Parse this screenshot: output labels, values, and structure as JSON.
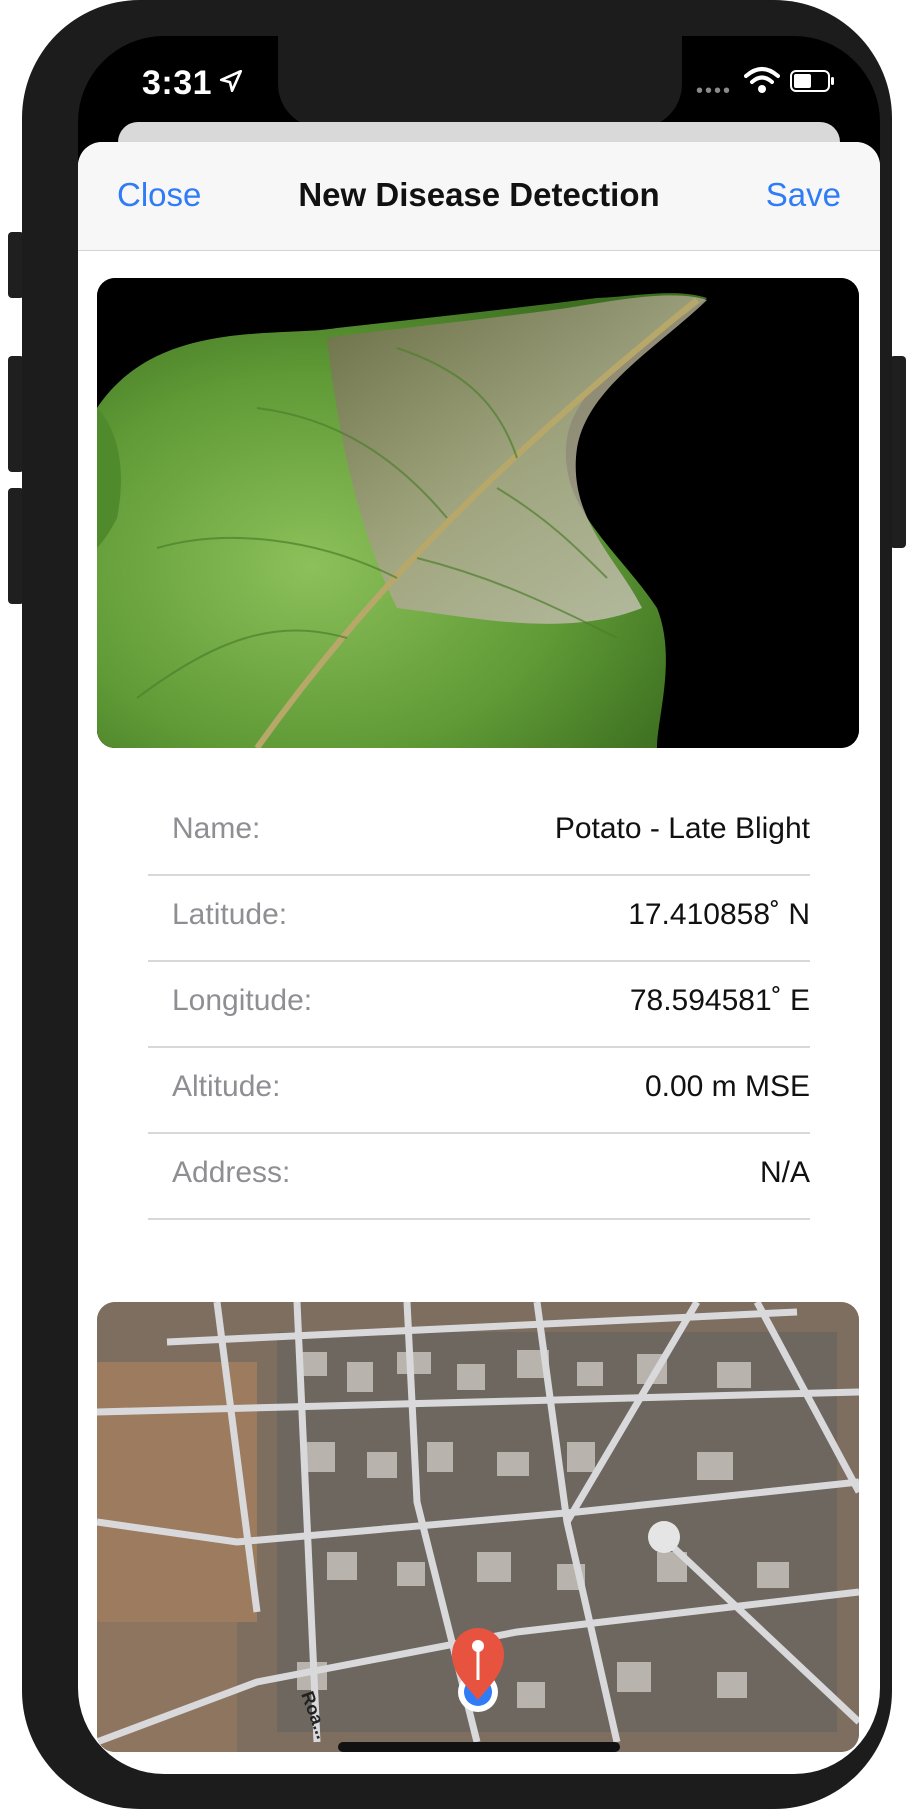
{
  "status_bar": {
    "time": "3:31",
    "icons": [
      "location-arrow-icon",
      "cellular-dots-icon",
      "wifi-icon",
      "battery-icon"
    ]
  },
  "nav": {
    "close_label": "Close",
    "title": "New Disease Detection",
    "save_label": "Save"
  },
  "details": [
    {
      "label": "Name:",
      "value": "Potato - Late Blight"
    },
    {
      "label": "Latitude:",
      "value": "17.410858˚ N"
    },
    {
      "label": "Longitude:",
      "value": "78.594581˚ E"
    },
    {
      "label": "Altitude:",
      "value": "0.00 m MSE"
    },
    {
      "label": "Address:",
      "value": "N/A"
    }
  ],
  "map": {
    "road_label": "Roa..."
  },
  "colors": {
    "accent": "#2f7cf6",
    "pin": "#e8533f",
    "user_dot": "#2f7cf6"
  }
}
